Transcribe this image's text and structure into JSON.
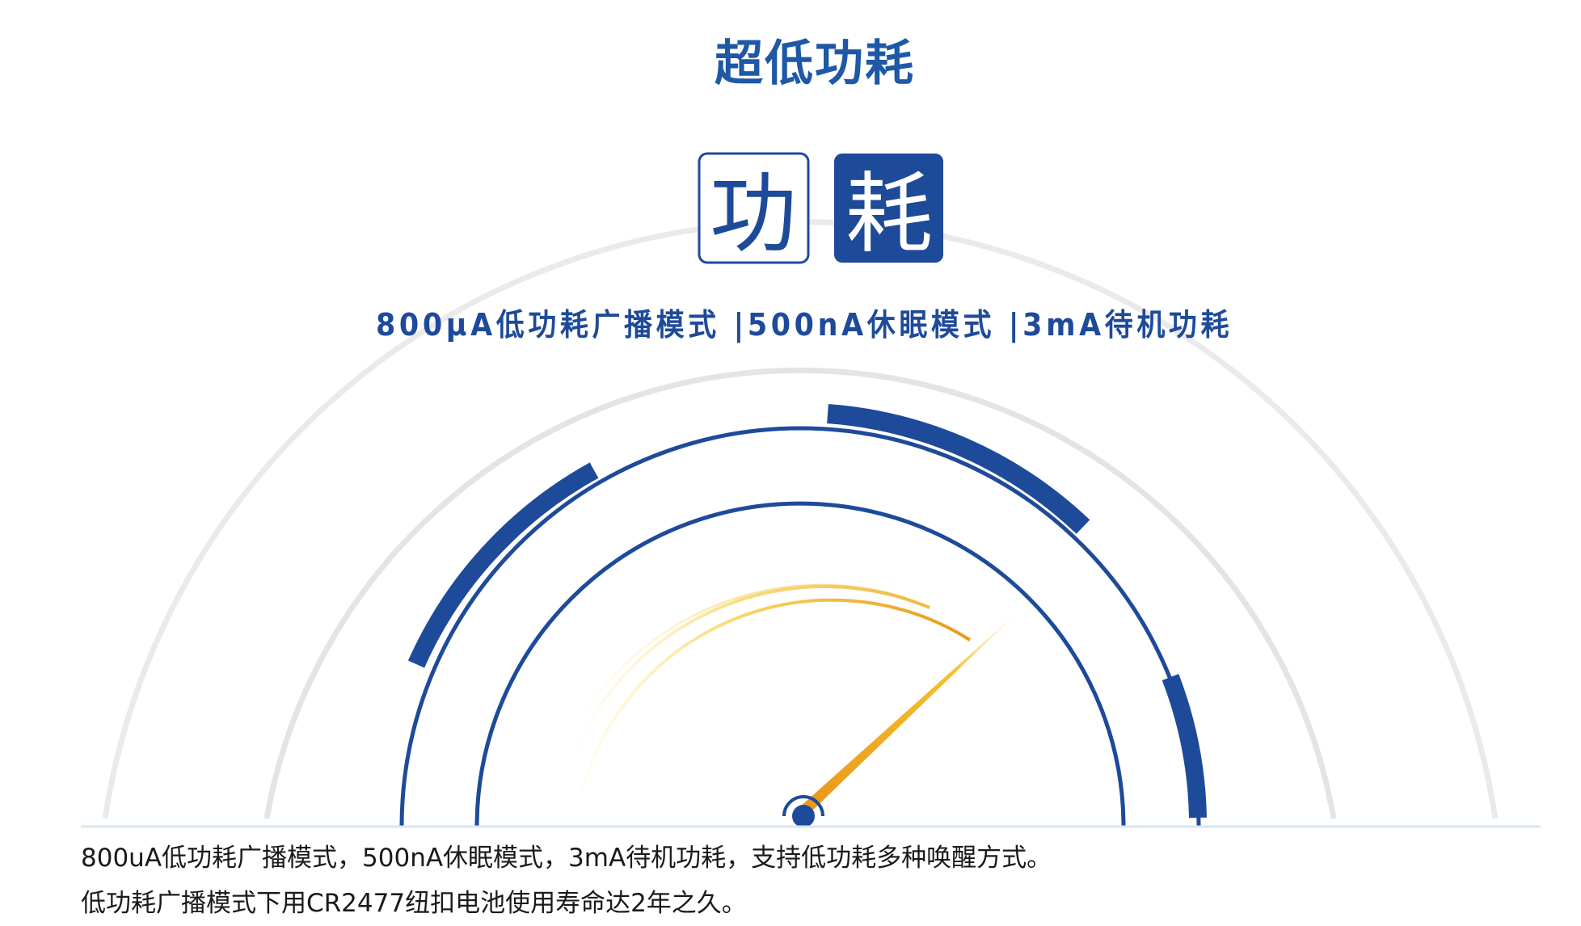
{
  "page": {
    "title": "超低功耗"
  },
  "badge": {
    "char_outline": "功",
    "char_filled": "耗"
  },
  "specs": {
    "line": "800μA低功耗广播模式 |500nA休眠模式 |3mA待机功耗"
  },
  "description": {
    "line1": "800uA低功耗广播模式，500nA休眠模式，3mA待机功耗，支持低功耗多种唤醒方式。",
    "line2": "低功耗广播模式下用CR2477纽扣电池使用寿命达2年之久。"
  },
  "colors": {
    "brand_blue": "#1e4a9a",
    "title_blue": "#1e58a6",
    "needle_gold": "#f0a020",
    "arc_gray": "#e4e4e4"
  },
  "icons": {
    "gauge": "speedometer-icon"
  }
}
